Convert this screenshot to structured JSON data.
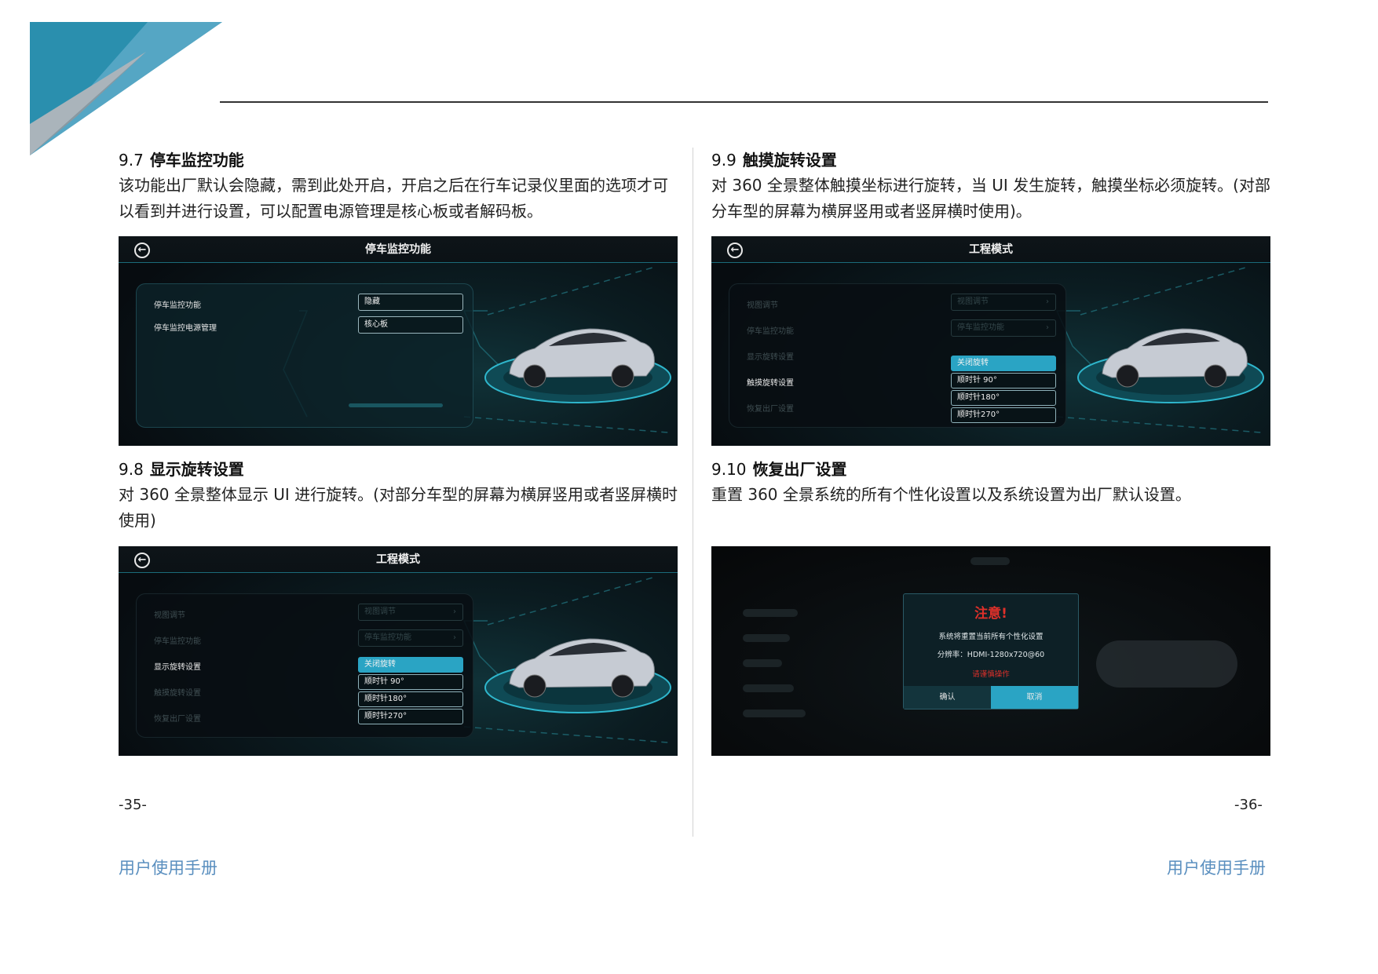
{
  "left": {
    "s97": {
      "num": "9.7",
      "title": "停车监控功能",
      "body": "该功能出厂默认会隐藏，需到此处开启，开启之后在行车记录仪里面的选项才可以看到并进行设置，可以配置电源管理是核心板或者解码板。"
    },
    "screen1": {
      "title": "停车监控功能",
      "rows": [
        {
          "label": "停车监控功能",
          "value": "隐藏"
        },
        {
          "label": "停车监控电源管理",
          "value": "核心板"
        }
      ]
    },
    "s98": {
      "num": "9.8",
      "title": "显示旋转设置",
      "body": "对 360 全景整体显示 UI 进行旋转。(对部分车型的屏幕为横屏竖用或者竖屏横时使用)"
    },
    "screen2": {
      "title": "工程模式",
      "rows": [
        {
          "label": "视图调节",
          "value": "视图调节"
        },
        {
          "label": "停车监控功能",
          "value": "停车监控功能"
        },
        {
          "label": "显示旋转设置"
        },
        {
          "label": "触摸旋转设置"
        },
        {
          "label": "恢复出厂设置"
        }
      ],
      "options": [
        "关闭旋转",
        "顺时针 90°",
        "顺时针180°",
        "顺时针270°"
      ]
    },
    "page": "-35-",
    "footer": "用户使用手册"
  },
  "right": {
    "s99": {
      "num": "9.9",
      "title": "触摸旋转设置",
      "body": "对 360 全景整体触摸坐标进行旋转，当 UI 发生旋转，触摸坐标必须旋转。(对部分车型的屏幕为横屏竖用或者竖屏横时使用)。"
    },
    "screen3": {
      "title": "工程模式",
      "rows": [
        {
          "label": "视图调节",
          "value": "视图调节"
        },
        {
          "label": "停车监控功能",
          "value": "停车监控功能"
        },
        {
          "label": "显示旋转设置"
        },
        {
          "label": "触摸旋转设置"
        },
        {
          "label": "恢复出厂设置"
        }
      ],
      "options": [
        "关闭旋转",
        "顺时针 90°",
        "顺时针180°",
        "顺时针270°"
      ]
    },
    "s910": {
      "num": "9.10",
      "title": "恢复出厂设置",
      "body": "重置 360 全景系统的所有个性化设置以及系统设置为出厂默认设置。"
    },
    "dialog": {
      "title": "注意!",
      "message": "系统将重置当前所有个性化设置",
      "resolution": "分辨率：HDMI-1280x720@60",
      "warning": "请谨慎操作",
      "ok": "确认",
      "cancel": "取消"
    },
    "page": "-36-",
    "footer": "用户使用手册"
  },
  "colors": {
    "accent": "#2aa4c4",
    "footer": "#5a8fbf",
    "warning": "#e0302a",
    "corner_dark": "#2a8fae",
    "corner_light": "#9aa6ae"
  },
  "icons": {
    "back": "back-arrow-circle-icon",
    "chevron": "chevron-right-icon"
  }
}
